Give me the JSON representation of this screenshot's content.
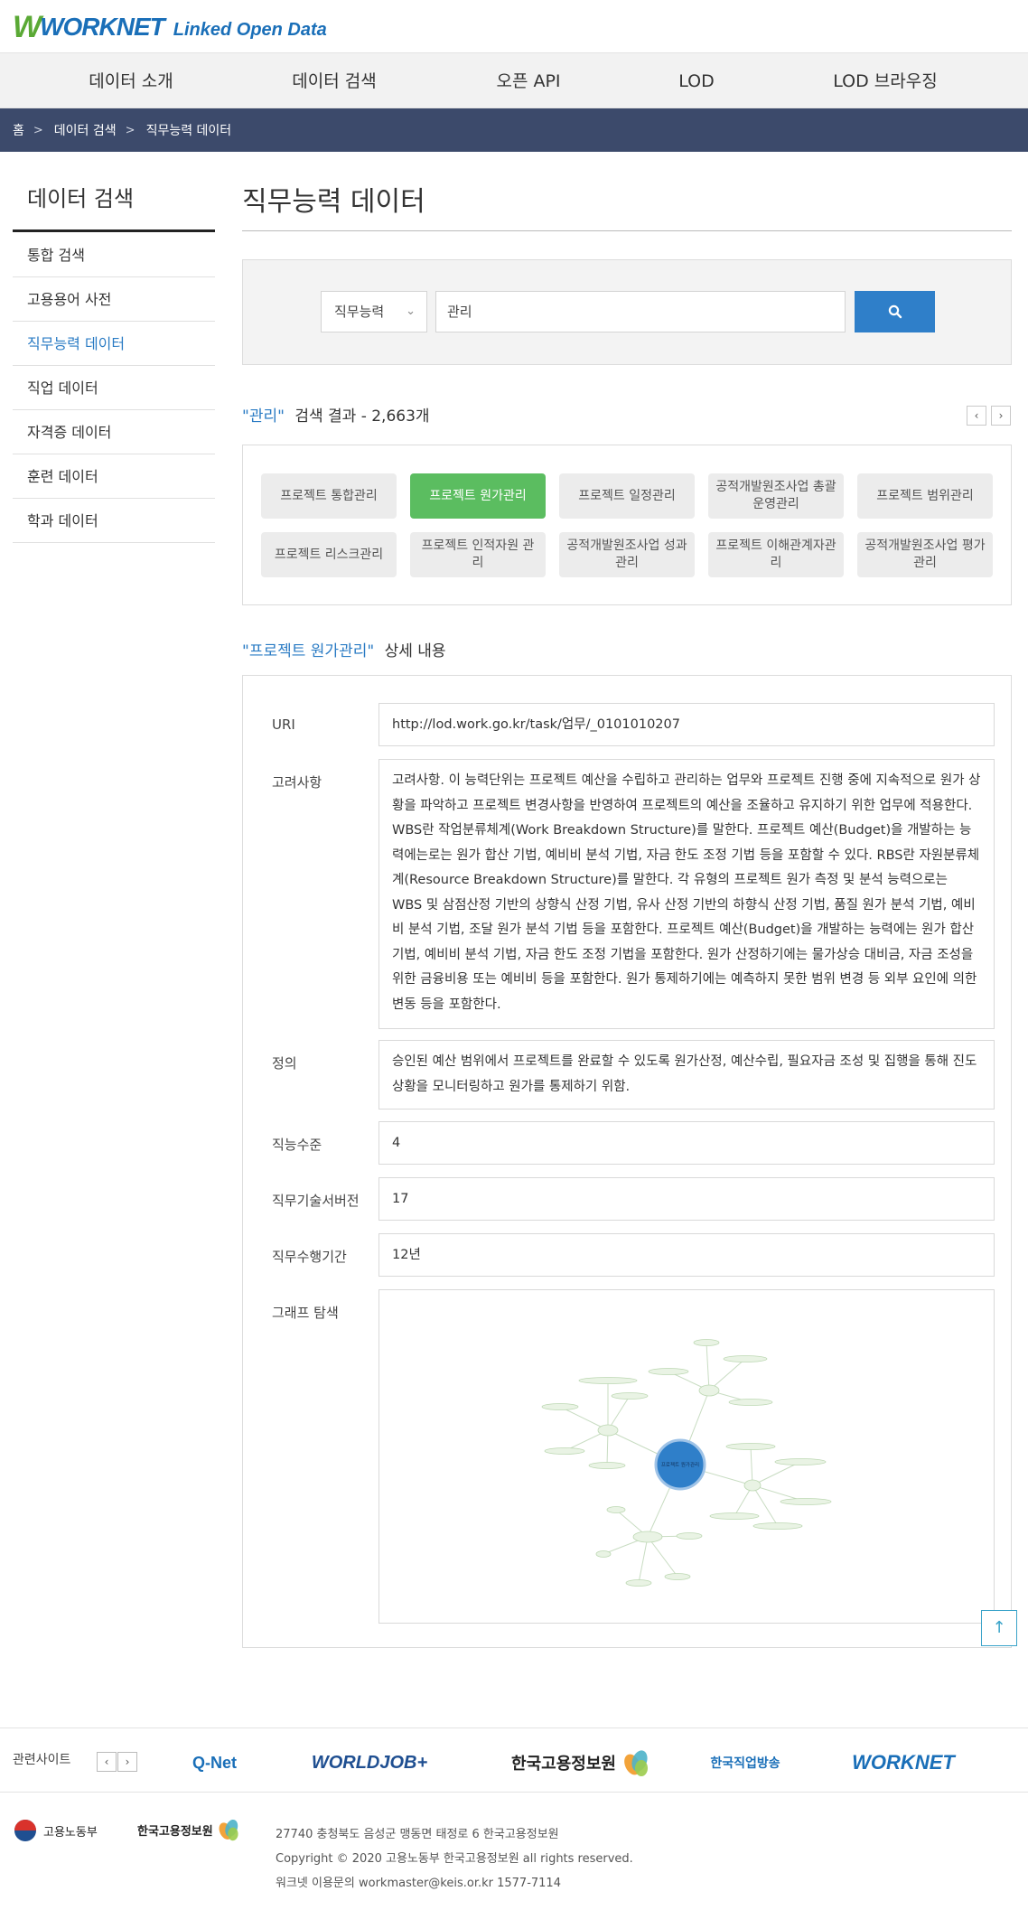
{
  "header": {
    "logo_main": "WORKNET",
    "logo_sub": "Linked Open Data"
  },
  "nav": [
    "데이터 소개",
    "데이터 검색",
    "오픈 API",
    "LOD",
    "LOD 브라우징"
  ],
  "breadcrumb": [
    "홈",
    "데이터 검색",
    "직무능력 데이터"
  ],
  "sidebar": {
    "title": "데이터 검색",
    "items": [
      "통합 검색",
      "고용용어 사전",
      "직무능력 데이터",
      "직업 데이터",
      "자격증 데이터",
      "훈련 데이터",
      "학과 데이터"
    ],
    "active_index": 2
  },
  "main": {
    "title": "직무능력 데이터",
    "search": {
      "category": "직무능력",
      "query": "관리"
    },
    "result": {
      "keyword": "\"관리\"",
      "text": "검색 결과 - 2,663개"
    },
    "pager": {
      "prev": "‹",
      "next": "›"
    },
    "tags": [
      "프로젝트 통합관리",
      "프로젝트 원가관리",
      "프로젝트 일정관리",
      "공적개발원조사업 총괄운영관리",
      "프로젝트 범위관리",
      "프로젝트 리스크관리",
      "프로젝트 인적자원 관리",
      "공적개발원조사업 성과관리",
      "프로젝트 이해관계자관리",
      "공적개발원조사업 평가관리"
    ],
    "active_tag": 1,
    "detail": {
      "keyword": "\"프로젝트 원가관리\"",
      "text": "상세 내용",
      "uri_label": "URI",
      "uri": "http://lod.work.go.kr/task/업무/_0101010207",
      "consider_label": "고려사항",
      "consider": "고려사항. 이 능력단위는 프로젝트 예산을 수립하고 관리하는 업무와 프로젝트 진행 중에 지속적으로 원가 상황을 파악하고 프로젝트 변경사항을 반영하여 프로젝트의 예산을 조율하고 유지하기 위한 업무에 적용한다. WBS란 작업분류체계(Work Breakdown Structure)를 말한다. 프로젝트 예산(Budget)을 개발하는 능력에는로는 원가 합산 기법, 예비비 분석 기법, 자금 한도 조정 기법 등을 포함할 수 있다. RBS란 자원분류체계(Resource Breakdown Structure)를 말한다. 각 유형의 프로젝트 원가 측정 및 분석 능력으로는 WBS 및 삼점산정 기반의 상향식 산정 기법, 유사 산정 기반의 하향식 산정 기법, 품질 원가 분석 기법, 예비비 분석 기법, 조달 원가 분석 기법 등을 포함한다. 프로젝트 예산(Budget)을 개발하는 능력에는 원가 합산 기법, 예비비 분석 기법, 자금 한도 조정 기법을 포함한다. 원가 산정하기에는 물가상승 대비금, 자금 조성을 위한 금융비용 또는 예비비 등을 포함한다. 원가 통제하기에는 예측하지 못한 범위 변경 등 외부 요인에 의한 변동 등을 포함한다.",
      "def_label": "정의",
      "definition": "승인된 예산 범위에서 프로젝트를 완료할 수 있도록 원가산정, 예산수립, 필요자금 조성 및 집행을 통해 진도상황을 모니터링하고 원가를 통제하기 위함.",
      "level_label": "직능수준",
      "level": "4",
      "version_label": "직무기술서버전",
      "version": "17",
      "period_label": "직무수행기간",
      "period": "12년",
      "graph_label": "그래프 탐색",
      "graph_center": "프로젝트 원가관리"
    }
  },
  "footer": {
    "related_label": "관련사이트",
    "sites": [
      "Q-Net",
      "WORLDJOB+",
      "한국고용정보원",
      "한국직업방송",
      "WORKNET"
    ],
    "ministry": "고용노동부",
    "keis": "한국고용정보원",
    "address": "27740 충청북도 음성군 맹동면 태정로 6 한국고용정보원",
    "copyright": "Copyright © 2020 고용노동부 한국고용정보원 all rights reserved.",
    "contact": "워크넷 이용문의 workmaster@keis.or.kr 1577-7114"
  }
}
